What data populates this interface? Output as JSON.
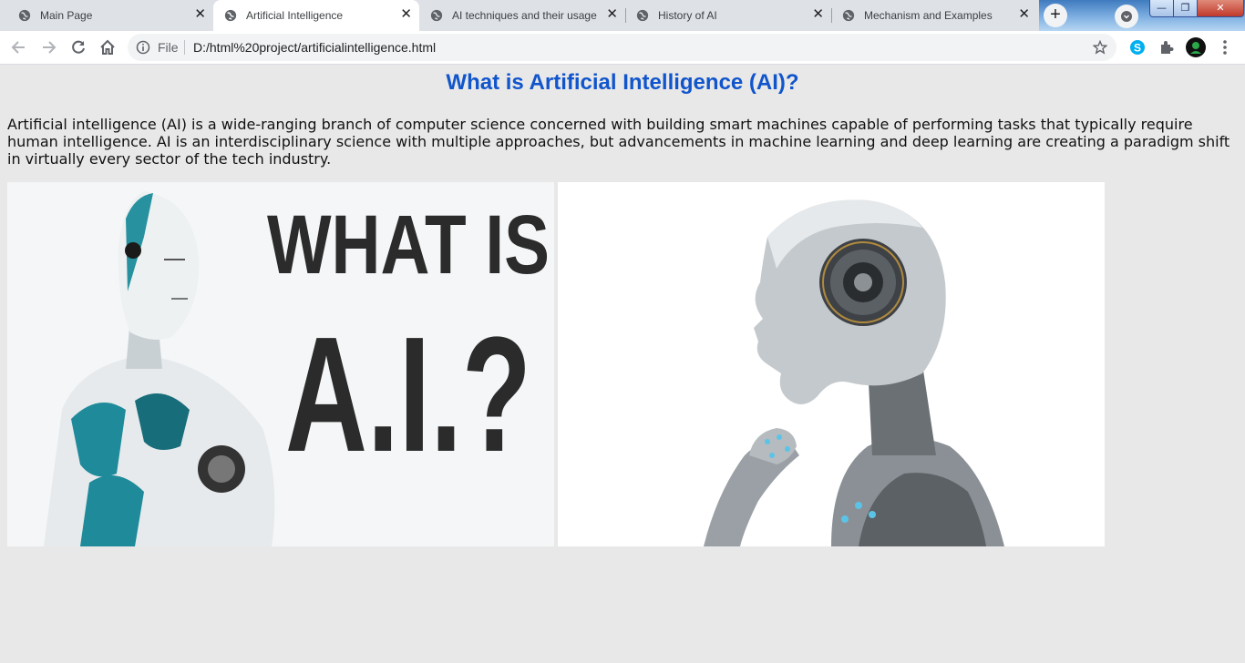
{
  "browser": {
    "tabs": [
      {
        "title": "Main Page",
        "active": false
      },
      {
        "title": "Artificial Intelligence",
        "active": true
      },
      {
        "title": "AI techniques and their usage",
        "active": false
      },
      {
        "title": "History of AI",
        "active": false
      },
      {
        "title": "Mechanism and Examples",
        "active": false
      }
    ],
    "tab_close_glyph": "✕",
    "new_tab_glyph": "+",
    "window_controls": {
      "minimize": "—",
      "maximize": "❐",
      "close": "✕"
    },
    "address_bar": {
      "scheme_label": "File",
      "url": "D:/html%20project/artificialintelligence.html"
    },
    "toolbar_icons": [
      "back-icon",
      "forward-icon",
      "reload-icon",
      "home-icon",
      "info-icon",
      "star-icon",
      "skype-icon",
      "extensions-icon",
      "profile-avatar",
      "menu-icon"
    ]
  },
  "page": {
    "heading": "What is Artificial Intelligence (AI)?",
    "paragraph": "Artificial intelligence (AI) is a wide-ranging branch of computer science concerned with building smart machines capable of performing tasks that typically require human intelligence. AI is an interdisciplinary science with multiple approaches, but advancements in machine learning and deep learning are creating a paradigm shift in virtually every sector of the tech industry.",
    "images": [
      {
        "text_line1": "WHAT IS",
        "text_line2": "A.I.?"
      },
      {}
    ]
  },
  "colors": {
    "heading": "#1155cc",
    "page_background": "#e8e8e8",
    "tabstrip": "#dee1e6",
    "accent_teal": "#1e8a9a"
  }
}
